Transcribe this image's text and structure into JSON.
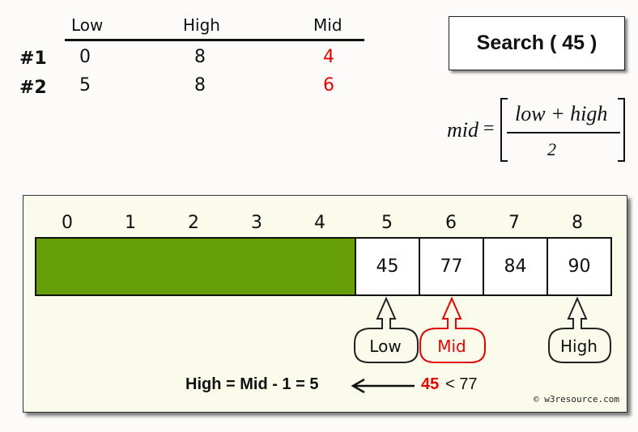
{
  "table": {
    "headers": [
      "Low",
      "High",
      "Mid"
    ],
    "rows": [
      {
        "label": "#1",
        "low": "0",
        "high": "8",
        "mid": "4"
      },
      {
        "label": "#2",
        "low": "5",
        "high": "8",
        "mid": "6"
      }
    ]
  },
  "search": {
    "label": "Search ( 45 )"
  },
  "formula": {
    "lhs": "mid",
    "eq": "=",
    "numerator": "low + high",
    "denominator": "2"
  },
  "array": {
    "indices": [
      "0",
      "1",
      "2",
      "3",
      "4",
      "5",
      "6",
      "7",
      "8"
    ],
    "eliminated_range": [
      0,
      4
    ],
    "values": [
      {
        "index": 5,
        "value": "45"
      },
      {
        "index": 6,
        "value": "77"
      },
      {
        "index": 7,
        "value": "84"
      },
      {
        "index": 8,
        "value": "90"
      }
    ]
  },
  "pointers": [
    {
      "label": "Low",
      "index": 5,
      "color": "#222222"
    },
    {
      "label": "Mid",
      "index": 6,
      "color": "#e00000"
    },
    {
      "label": "High",
      "index": 8,
      "color": "#222222"
    }
  ],
  "step": {
    "result": "High = Mid - 1 = 5",
    "target": "45",
    "comparison": "< 77"
  },
  "copyright": "© w3resource.com",
  "colors": {
    "accent_red": "#e00000",
    "eliminated_green": "#669e07",
    "panel_bg": "#fbfbec"
  }
}
